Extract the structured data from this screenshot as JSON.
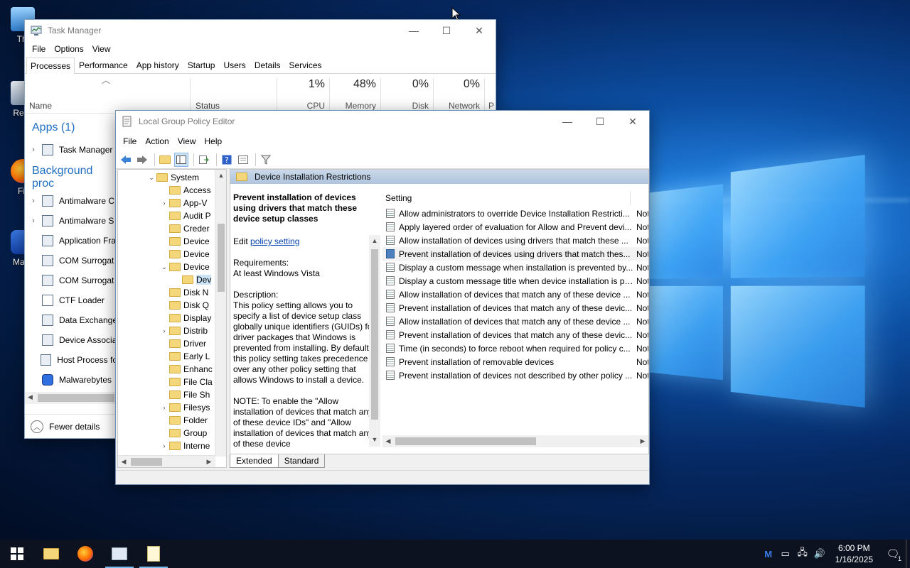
{
  "desktop": {
    "icons": [
      {
        "label": "Thi",
        "name": "this-pc"
      },
      {
        "label": "Recy",
        "name": "recycle-bin"
      },
      {
        "label": "Fir",
        "name": "firefox"
      },
      {
        "label": "Malw",
        "name": "malwarebytes"
      }
    ]
  },
  "colors": {
    "accent": "#1e6ec2",
    "desktop_dark": "#031739",
    "taskbar": "#0c1220"
  },
  "taskmgr": {
    "title": "Task Manager",
    "menu": [
      "File",
      "Options",
      "View"
    ],
    "tabs": [
      "Processes",
      "Performance",
      "App history",
      "Startup",
      "Users",
      "Details",
      "Services"
    ],
    "columns": {
      "name": "Name",
      "status": "Status",
      "cpu_pct": "1%",
      "cpu": "CPU",
      "mem_pct": "48%",
      "mem": "Memory",
      "disk_pct": "0%",
      "disk": "Disk",
      "net_pct": "0%",
      "net": "Network",
      "extra": "P"
    },
    "groups": {
      "apps": "Apps (1)",
      "background": "Background proc"
    },
    "apps": [
      "Task Manager"
    ],
    "background": [
      "Antimalware C",
      "Antimalware S",
      "Application Fra",
      "COM Surrogat",
      "COM Surrogat",
      "CTF Loader",
      "Data Exchange",
      "Device Associa",
      "Host Process fo",
      "Malwarebytes"
    ],
    "fewer_details": "Fewer details"
  },
  "gpedit": {
    "title": "Local Group Policy Editor",
    "menu": [
      "File",
      "Action",
      "View",
      "Help"
    ],
    "tree": [
      {
        "label": "System",
        "chev": "⌄"
      },
      {
        "label": "Access",
        "chev": ""
      },
      {
        "label": "App-V",
        "chev": "›"
      },
      {
        "label": "Audit P",
        "chev": ""
      },
      {
        "label": "Creder",
        "chev": ""
      },
      {
        "label": "Device",
        "chev": ""
      },
      {
        "label": "Device",
        "chev": ""
      },
      {
        "label": "Device",
        "chev": "⌄"
      },
      {
        "label": "Dev",
        "chev": ""
      },
      {
        "label": "Disk N",
        "chev": ""
      },
      {
        "label": "Disk Q",
        "chev": ""
      },
      {
        "label": "Display",
        "chev": ""
      },
      {
        "label": "Distrib",
        "chev": "›"
      },
      {
        "label": "Driver",
        "chev": ""
      },
      {
        "label": "Early L",
        "chev": ""
      },
      {
        "label": "Enhanc",
        "chev": ""
      },
      {
        "label": "File Cla",
        "chev": ""
      },
      {
        "label": "File Sh",
        "chev": ""
      },
      {
        "label": "Filesys",
        "chev": "›"
      },
      {
        "label": "Folder",
        "chev": ""
      },
      {
        "label": "Group",
        "chev": ""
      },
      {
        "label": "Interne",
        "chev": "›"
      }
    ],
    "panel_title": "Device Installation Restrictions",
    "description": {
      "heading": "Prevent installation of devices using drivers that match these device setup classes",
      "edit_prefix": "Edit",
      "edit_link": "policy setting",
      "requirements_label": "Requirements:",
      "requirements": "At least Windows Vista",
      "description_label": "Description:",
      "description": "This policy setting allows you to specify a list of device setup class globally unique identifiers (GUIDs) for driver packages that Windows is prevented from installing. By default, this policy setting takes precedence over any other policy setting that allows Windows to install a device.",
      "note": "NOTE: To enable the \"Allow installation of devices that match any of these device IDs\" and \"Allow installation of devices that match any of these device"
    },
    "settings_header": "Setting",
    "settings": [
      {
        "name": "Allow administrators to override Device Installation Restricti...",
        "state": "Not"
      },
      {
        "name": "Apply layered order of evaluation for Allow and Prevent devi...",
        "state": "Not"
      },
      {
        "name": "Allow installation of devices using drivers that match these ...",
        "state": "Not"
      },
      {
        "name": "Prevent installation of devices using drivers that match thes...",
        "state": "Not"
      },
      {
        "name": "Display a custom message when installation is prevented by...",
        "state": "Not"
      },
      {
        "name": "Display a custom message title when device installation is pr...",
        "state": "Not"
      },
      {
        "name": "Allow installation of devices that match any of these device ...",
        "state": "Not"
      },
      {
        "name": "Prevent installation of devices that match any of these devic...",
        "state": "Not"
      },
      {
        "name": "Allow installation of devices that match any of these device ...",
        "state": "Not"
      },
      {
        "name": "Prevent installation of devices that match any of these devic...",
        "state": "Not"
      },
      {
        "name": "Time (in seconds) to force reboot when required for policy c...",
        "state": "Not"
      },
      {
        "name": "Prevent installation of removable devices",
        "state": "Not"
      },
      {
        "name": "Prevent installation of devices not described by other policy ...",
        "state": "Not"
      }
    ],
    "view_tabs": [
      "Extended",
      "Standard"
    ]
  },
  "taskbar": {
    "time": "6:00 PM",
    "date": "1/16/2025",
    "notifications": "1"
  }
}
